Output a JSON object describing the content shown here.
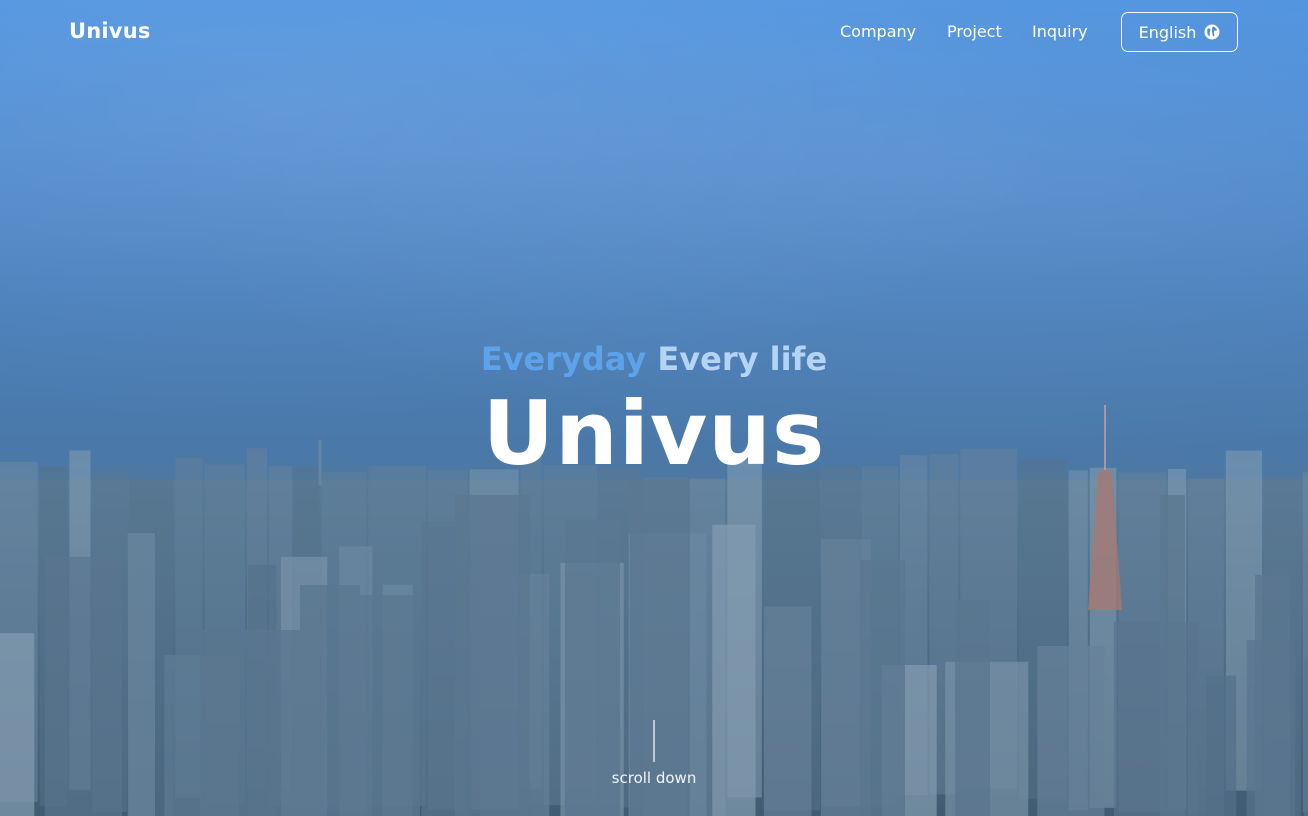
{
  "header": {
    "logo": "Univus",
    "nav": [
      {
        "label": "Company"
      },
      {
        "label": "Project"
      },
      {
        "label": "Inquiry"
      }
    ],
    "language_button": {
      "label": "English",
      "icon": "globe-icon"
    }
  },
  "hero": {
    "tagline_part1": "Everyday",
    "tagline_part2": "Every life",
    "title": "Univus",
    "scroll_label": "scroll down",
    "background_image": "city-skyline-photo"
  },
  "colors": {
    "tagline_accent": "#5ea3ea",
    "tagline_light": "#b4d4f5",
    "sky_top": "#4f93df",
    "ground": "#4b6880"
  }
}
